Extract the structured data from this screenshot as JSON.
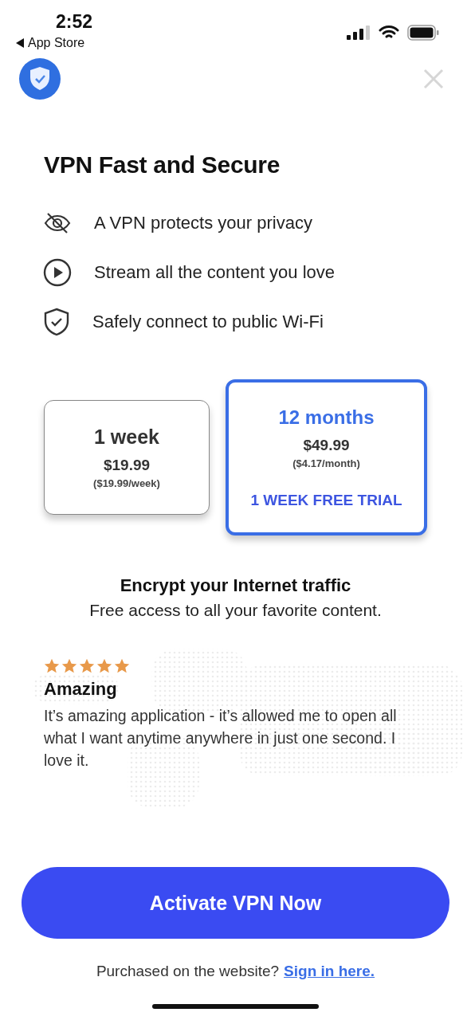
{
  "status_bar": {
    "time": "2:52",
    "back_label": "App Store"
  },
  "title": "VPN Fast and Secure",
  "features": [
    {
      "kind": "privacy",
      "text": "A VPN protects your privacy"
    },
    {
      "kind": "stream",
      "text": "Stream all the content you love"
    },
    {
      "kind": "secure",
      "text": "Safely connect to public Wi-Fi"
    }
  ],
  "plans": [
    {
      "name": "1 week",
      "price": "$19.99",
      "rate": "($19.99/week)",
      "selected": false
    },
    {
      "name": "12 months",
      "price": "$49.99",
      "rate": "($4.17/month)",
      "trial": "1 WEEK FREE TRIAL",
      "selected": true
    }
  ],
  "headline": "Encrypt your Internet traffic",
  "subline": "Free access to all your favorite content.",
  "review": {
    "stars": 5,
    "title": "Amazing",
    "text": "It’s amazing application - it’s allowed me to open all what I want anytime anywhere in just one second. I love it."
  },
  "cta": "Activate VPN Now",
  "footer": {
    "text": "Purchased on the website?",
    "link": "Sign in here."
  }
}
